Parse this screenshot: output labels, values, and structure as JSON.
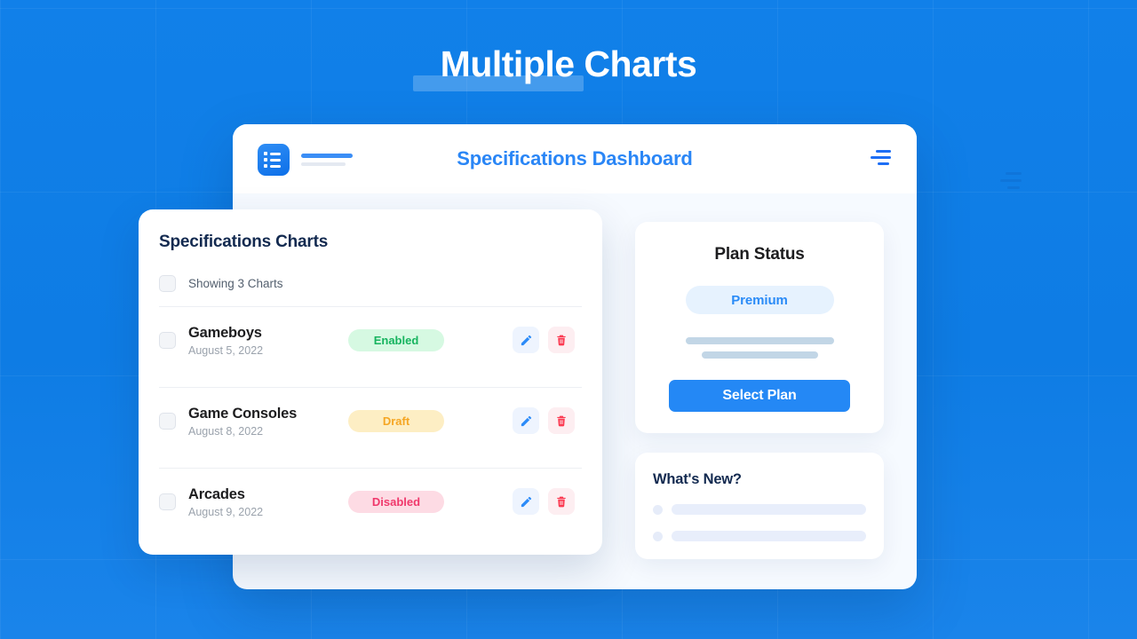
{
  "page": {
    "title": "Multiple Charts",
    "background_color": "#127fe8",
    "accent_color": "#2a86f6"
  },
  "dashboard": {
    "title": "Specifications Dashboard",
    "logo_icon": "list-logo-icon",
    "menu_icon": "hamburger-menu-icon"
  },
  "charts_panel": {
    "title": "Specifications Charts",
    "showing_label": "Showing 3 Charts",
    "rows": [
      {
        "name": "Gameboys",
        "date": "August 5, 2022",
        "status": "Enabled",
        "status_kind": "enabled",
        "status_color": "#17b45f",
        "status_bg": "#d6f9e2",
        "edit_icon": "pencil-icon",
        "delete_icon": "trash-icon"
      },
      {
        "name": "Game Consoles",
        "date": "August 8, 2022",
        "status": "Draft",
        "status_kind": "draft",
        "status_color": "#f5a623",
        "status_bg": "#fdeec4",
        "edit_icon": "pencil-icon",
        "delete_icon": "trash-icon"
      },
      {
        "name": "Arcades",
        "date": "August 9, 2022",
        "status": "Disabled",
        "status_kind": "disabled",
        "status_color": "#f0386b",
        "status_bg": "#fddbe4",
        "edit_icon": "pencil-icon",
        "delete_icon": "trash-icon"
      }
    ]
  },
  "plan_card": {
    "title": "Plan Status",
    "plan_badge": "Premium",
    "button_label": "Select Plan",
    "button_color": "#2488f5"
  },
  "news_card": {
    "title": "What's New?",
    "items": [
      {
        "id": 1
      },
      {
        "id": 2
      }
    ]
  }
}
